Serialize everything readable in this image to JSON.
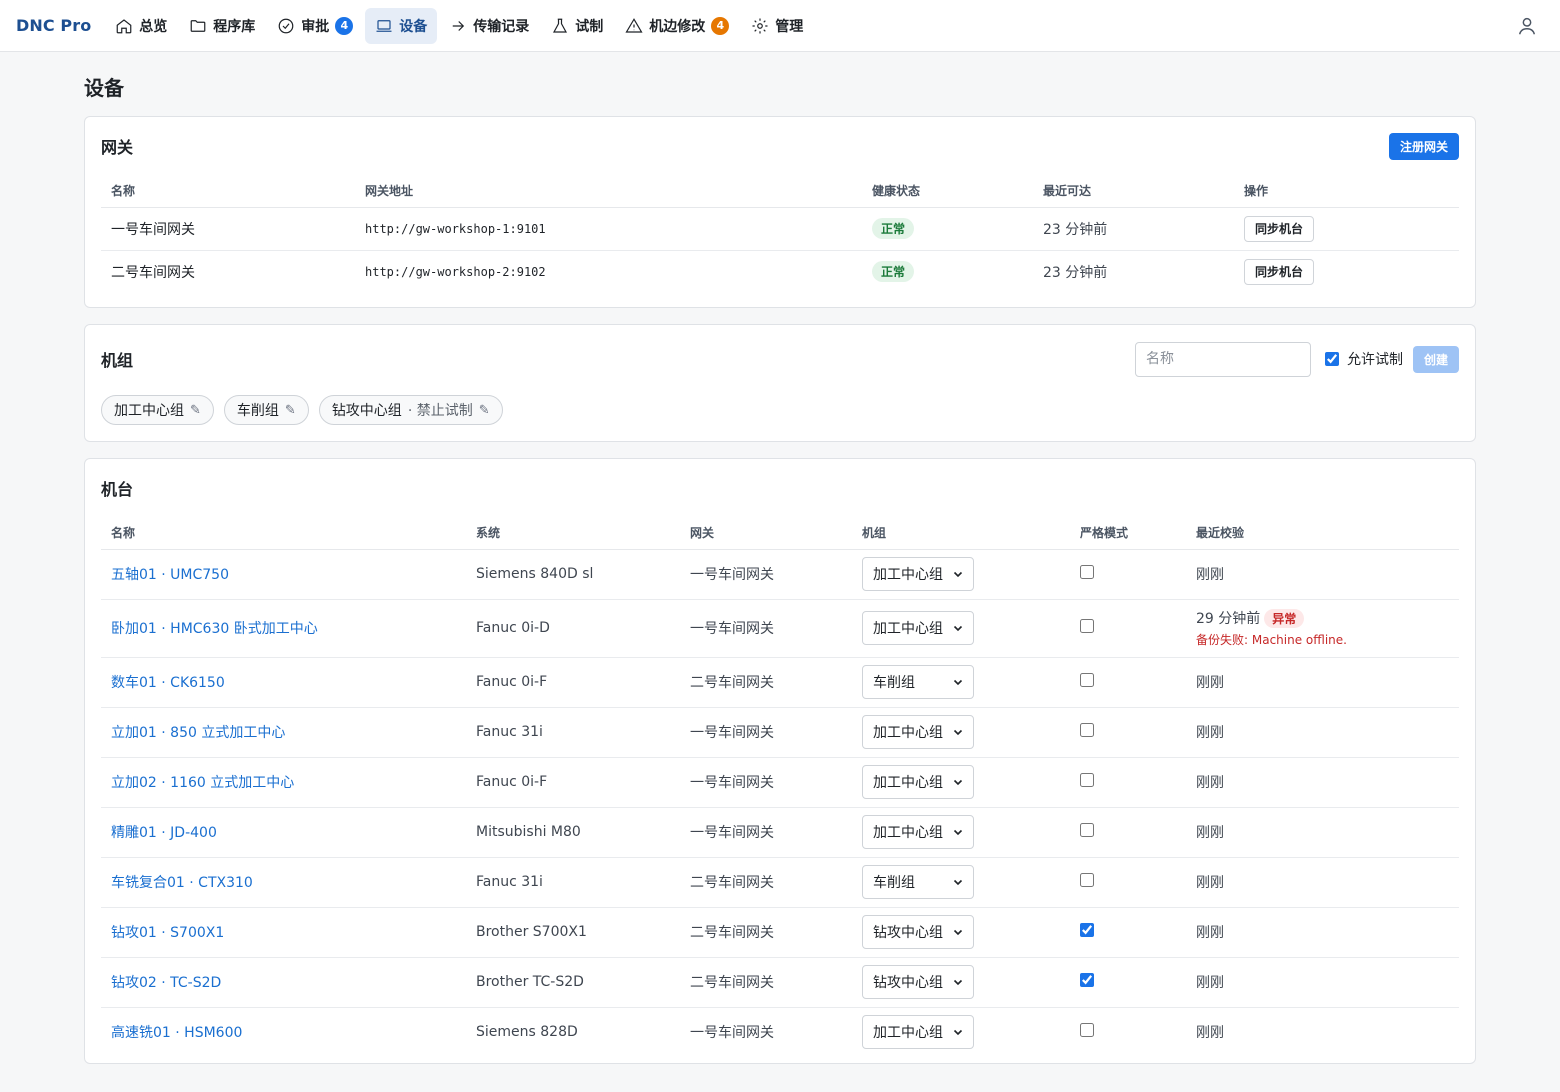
{
  "app": {
    "brand": "DNC Pro"
  },
  "nav": {
    "items": [
      {
        "label": "总览",
        "icon": "home-icon"
      },
      {
        "label": "程序库",
        "icon": "folder-icon"
      },
      {
        "label": "审批",
        "icon": "check-circle-icon",
        "badge": "4"
      },
      {
        "label": "设备",
        "icon": "monitor-icon",
        "active": true
      },
      {
        "label": "传输记录",
        "icon": "arrow-right-icon"
      },
      {
        "label": "试制",
        "icon": "flask-icon"
      },
      {
        "label": "机边修改",
        "icon": "warning-icon",
        "badge": "4"
      },
      {
        "label": "管理",
        "icon": "gear-icon"
      }
    ],
    "user_icon": "user-icon"
  },
  "page": {
    "title": "设备"
  },
  "gateways": {
    "title": "网关",
    "register_label": "注册网关",
    "columns": [
      "名称",
      "网关地址",
      "健康状态",
      "最近可达",
      "操作"
    ],
    "rows": [
      {
        "name": "一号车间网关",
        "address": "http://gw-workshop-1:9101",
        "health": "正常",
        "last_seen": "23 分钟前",
        "action": "同步机台"
      },
      {
        "name": "二号车间网关",
        "address": "http://gw-workshop-2:9102",
        "health": "正常",
        "last_seen": "23 分钟前",
        "action": "同步机台"
      }
    ]
  },
  "groups": {
    "title": "机组",
    "name_placeholder": "名称",
    "allow_trial_label": "允许试制",
    "allow_trial_checked": true,
    "create_label": "创建",
    "chips": [
      {
        "name": "加工中心组",
        "note": ""
      },
      {
        "name": "车削组",
        "note": ""
      },
      {
        "name": "钻攻中心组",
        "note": "· 禁止试制"
      }
    ]
  },
  "machines": {
    "title": "机台",
    "columns": [
      "名称",
      "系统",
      "网关",
      "机组",
      "严格模式",
      "最近校验"
    ],
    "rows": [
      {
        "name": "五轴01 · UMC750",
        "system": "Siemens 840D sl",
        "gateway": "一号车间网关",
        "group": "加工中心组",
        "strict": false,
        "last_check": "刚刚"
      },
      {
        "name": "卧加01 · HMC630 卧式加工中心",
        "system": "Fanuc 0i-D",
        "gateway": "一号车间网关",
        "group": "加工中心组",
        "strict": false,
        "last_check": "29 分钟前",
        "status": "异常",
        "error": "备份失败: Machine offline."
      },
      {
        "name": "数车01 · CK6150",
        "system": "Fanuc 0i-F",
        "gateway": "二号车间网关",
        "group": "车削组",
        "strict": false,
        "last_check": "刚刚"
      },
      {
        "name": "立加01 · 850 立式加工中心",
        "system": "Fanuc 31i",
        "gateway": "一号车间网关",
        "group": "加工中心组",
        "strict": false,
        "last_check": "刚刚"
      },
      {
        "name": "立加02 · 1160 立式加工中心",
        "system": "Fanuc 0i-F",
        "gateway": "一号车间网关",
        "group": "加工中心组",
        "strict": false,
        "last_check": "刚刚"
      },
      {
        "name": "精雕01 · JD-400",
        "system": "Mitsubishi M80",
        "gateway": "一号车间网关",
        "group": "加工中心组",
        "strict": false,
        "last_check": "刚刚"
      },
      {
        "name": "车铣复合01 · CTX310",
        "system": "Fanuc 31i",
        "gateway": "二号车间网关",
        "group": "车削组",
        "strict": false,
        "last_check": "刚刚"
      },
      {
        "name": "钻攻01 · S700X1",
        "system": "Brother S700X1",
        "gateway": "二号车间网关",
        "group": "钻攻中心组",
        "strict": true,
        "last_check": "刚刚"
      },
      {
        "name": "钻攻02 · TC-S2D",
        "system": "Brother TC-S2D",
        "gateway": "二号车间网关",
        "group": "钻攻中心组",
        "strict": true,
        "last_check": "刚刚"
      },
      {
        "name": "高速铣01 · HSM600",
        "system": "Siemens 828D",
        "gateway": "一号车间网关",
        "group": "加工中心组",
        "strict": false,
        "last_check": "刚刚"
      }
    ]
  },
  "colors": {
    "accent": "#1a73e8",
    "brand": "#1d4f91",
    "ok": "#1b7a3a",
    "error": "#c62828",
    "badge_orange": "#e67700"
  }
}
